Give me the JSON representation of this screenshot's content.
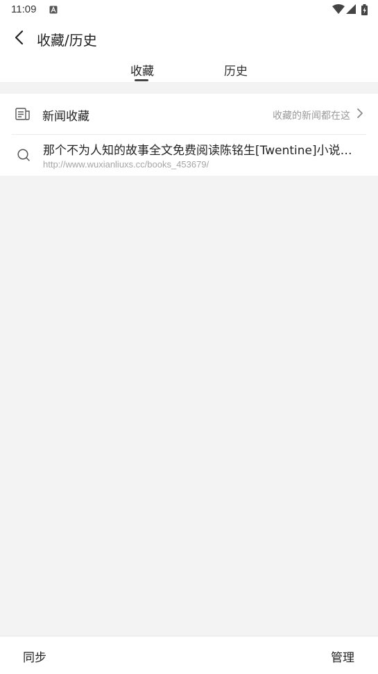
{
  "status_bar": {
    "time": "11:09",
    "icons": [
      "app-notification-icon",
      "wifi-icon",
      "cell-signal-icon",
      "battery-charging-icon"
    ]
  },
  "header": {
    "back_icon": "chevron-left-icon",
    "title": "收藏/历史"
  },
  "tabs": [
    {
      "label": "收藏",
      "active": true
    },
    {
      "label": "历史",
      "active": false
    }
  ],
  "news_favorites": {
    "icon": "news-icon",
    "label": "新闻收藏",
    "hint": "收藏的新闻都在这",
    "chevron": "chevron-right-icon"
  },
  "favorites": [
    {
      "icon": "search-icon",
      "title": "那个不为人知的故事全文免费阅读陈铭生[Twentine]小说 - 无限小说网",
      "url": "http://www.wuxianliuxs.cc/books_453679/"
    }
  ],
  "bottom_bar": {
    "sync_label": "同步",
    "manage_label": "管理"
  },
  "colors": {
    "background": "#f3f3f3",
    "surface": "#ffffff",
    "primary_text": "#222222",
    "secondary_text": "#9a9a9a"
  }
}
